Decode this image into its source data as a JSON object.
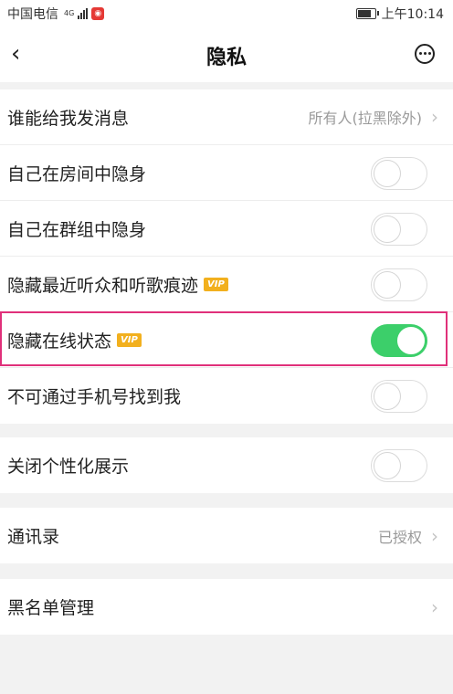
{
  "status_bar": {
    "carrier": "中国电信",
    "network": "4G",
    "time": "上午10:14"
  },
  "header": {
    "title": "隐私",
    "back_icon": "chevron-left-icon",
    "more_icon": "more-circle-icon"
  },
  "section1": [
    {
      "label": "谁能给我发消息",
      "value": "所有人(拉黑除外)",
      "type": "link"
    },
    {
      "label": "自己在房间中隐身",
      "type": "toggle",
      "on": false
    },
    {
      "label": "自己在群组中隐身",
      "type": "toggle",
      "on": false
    },
    {
      "label": "隐藏最近听众和听歌痕迹",
      "vip": "VIP",
      "type": "toggle",
      "on": false
    },
    {
      "label": "隐藏在线状态",
      "vip": "VIP",
      "type": "toggle",
      "on": true
    },
    {
      "label": "不可通过手机号找到我",
      "type": "toggle",
      "on": false
    }
  ],
  "section2": [
    {
      "label": "关闭个性化展示",
      "type": "toggle",
      "on": false
    }
  ],
  "section3": [
    {
      "label": "通讯录",
      "value": "已授权",
      "type": "link"
    }
  ],
  "section4": [
    {
      "label": "黑名单管理",
      "type": "link"
    }
  ],
  "colors": {
    "toggle_on": "#3ccf6a",
    "vip_badge": "#f2b01e",
    "highlight": "#e0307a"
  }
}
